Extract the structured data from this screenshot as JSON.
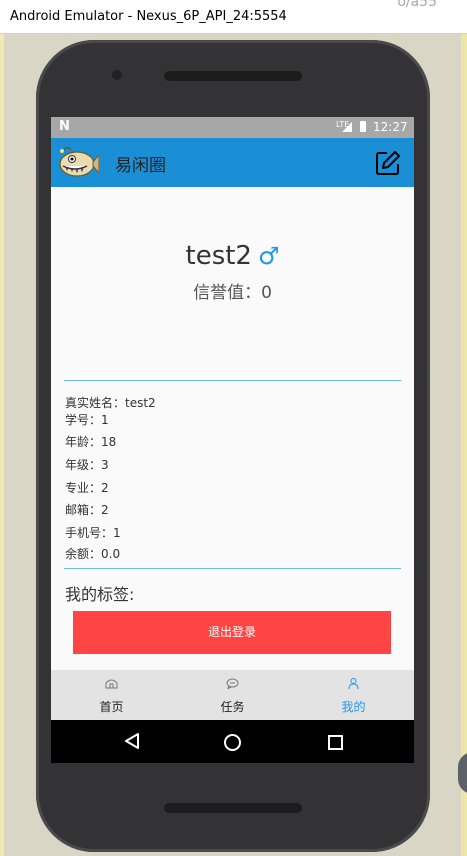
{
  "window": {
    "title": "Android Emulator - Nexus_6P_API_24:5554",
    "corner_text": "o/a55"
  },
  "statusbar": {
    "left_icon": "N",
    "network": "LTE",
    "time": "12:27"
  },
  "appbar": {
    "title": "易闲圈",
    "logo_icon": "anglerfish-logo-icon",
    "edit_icon": "edit-icon"
  },
  "profile": {
    "username": "test2",
    "gender_symbol": "♂",
    "credit": "信誉值：0",
    "info": [
      "真实姓名：test2",
      "学号：1",
      "年龄：18",
      "年级：3",
      "专业：2",
      "邮箱：2",
      "手机号：1",
      "余额：0.0"
    ],
    "tags_label": "我的标签:"
  },
  "logout_button": "退出登录",
  "bottom_nav": {
    "tabs": [
      {
        "label": "首页",
        "icon": "home-icon"
      },
      {
        "label": "任务",
        "icon": "chat-icon"
      },
      {
        "label": "我的",
        "icon": "person-icon"
      }
    ],
    "active": 2
  },
  "colors": {
    "accent": "#1a8fd6",
    "logout": "#ff4444",
    "active_tab": "#2196f3"
  }
}
